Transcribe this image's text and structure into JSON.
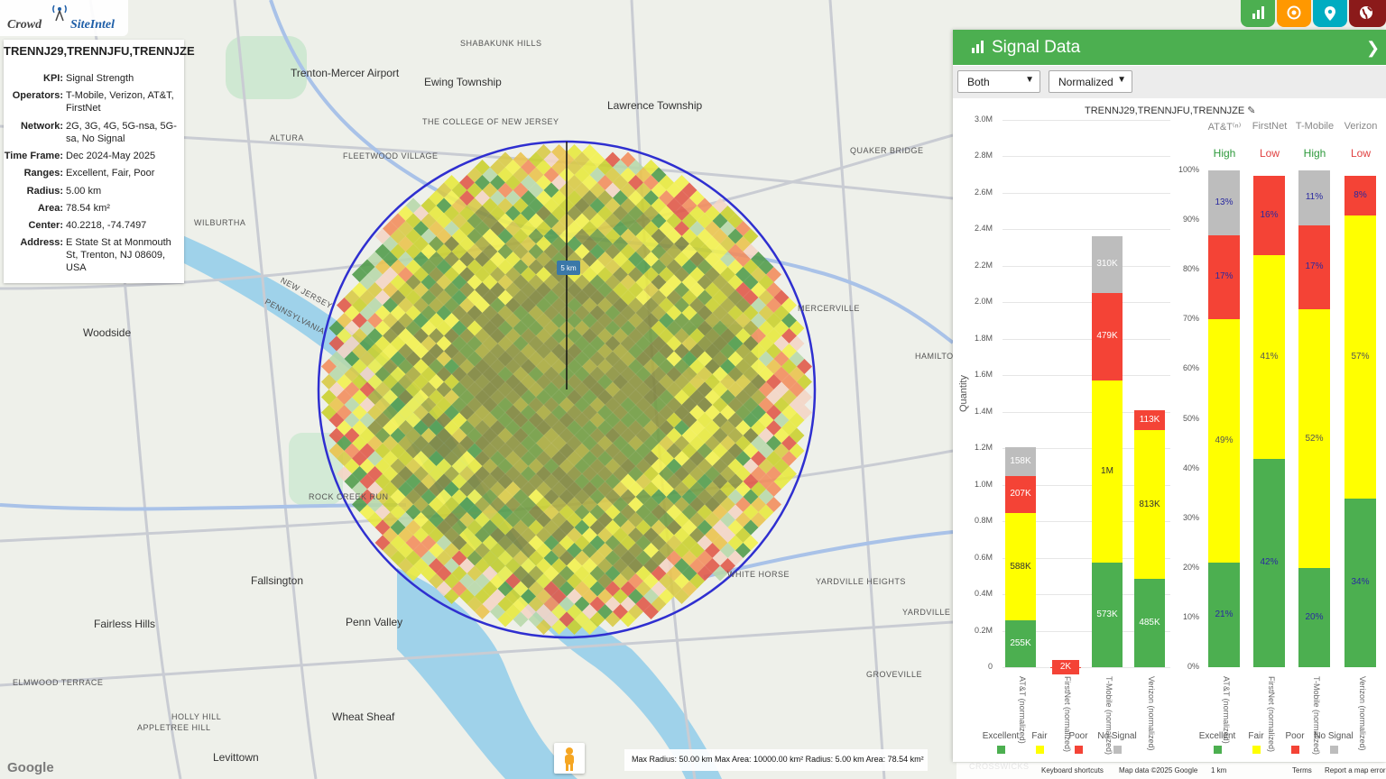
{
  "app": {
    "logo_left": "Crowd",
    "logo_right": "SiteIntel"
  },
  "info_card": {
    "title": "TRENNJ29,TRENNJFU,TRENNJZE",
    "rows": [
      {
        "key": "KPI:",
        "value": "Signal Strength"
      },
      {
        "key": "Operators:",
        "value": "T-Mobile, Verizon, AT&T, FirstNet"
      },
      {
        "key": "Network:",
        "value": "2G, 3G, 4G, 5G-nsa, 5G-sa, No Signal"
      },
      {
        "key": "Time Frame:",
        "value": "Dec 2024-May 2025"
      },
      {
        "key": "Ranges:",
        "value": "Excellent, Fair, Poor"
      },
      {
        "key": "Radius:",
        "value": "5.00 km"
      },
      {
        "key": "Area:",
        "value": "78.54 km²"
      },
      {
        "key": "Center:",
        "value": "40.2218, -74.7497"
      },
      {
        "key": "Address:",
        "value": "E State St at Monmouth St, Trenton, NJ 08609, USA"
      }
    ]
  },
  "map": {
    "places": [
      {
        "name": "Trenton-Mercer Airport",
        "style": "big"
      },
      {
        "name": "Ewing Township",
        "style": "big"
      },
      {
        "name": "Lawrence Township",
        "style": "big"
      },
      {
        "name": "Woodside",
        "style": "big"
      },
      {
        "name": "Fallsington",
        "style": "big"
      },
      {
        "name": "Fairless Hills",
        "style": "big"
      },
      {
        "name": "Penn Valley",
        "style": "big"
      },
      {
        "name": "Wheat Sheaf",
        "style": "big"
      },
      {
        "name": "Levittown",
        "style": "big"
      },
      {
        "name": "SHABAKUNK HILLS",
        "style": "small"
      },
      {
        "name": "THE COLLEGE OF NEW JERSEY",
        "style": "small"
      },
      {
        "name": "ALTURA",
        "style": "small"
      },
      {
        "name": "FLEETWOOD VILLAGE",
        "style": "small"
      },
      {
        "name": "WILBURTHA",
        "style": "small"
      },
      {
        "name": "QUAKER BRIDGE",
        "style": "small"
      },
      {
        "name": "MERCERVILLE",
        "style": "small"
      },
      {
        "name": "HAMILTON SQUARE",
        "style": "small"
      },
      {
        "name": "WHITE HORSE",
        "style": "small"
      },
      {
        "name": "YARDVILLE HEIGHTS",
        "style": "small"
      },
      {
        "name": "YARDVILLE",
        "style": "small"
      },
      {
        "name": "GROVEVILLE",
        "style": "small"
      },
      {
        "name": "ELMWOOD TERRACE",
        "style": "small"
      },
      {
        "name": "HOLLY HILL",
        "style": "small"
      },
      {
        "name": "APPLETREE HILL",
        "style": "small"
      },
      {
        "name": "ROCK CREEK RUN",
        "style": "small"
      },
      {
        "name": "CROSSWICKS",
        "style": "small"
      },
      {
        "name": "NEW JERSEY",
        "style": "small"
      },
      {
        "name": "PENNSYLVANIA",
        "style": "small"
      }
    ],
    "scale_label": "5 km",
    "radius_bar": "Max Radius: 50.00 km Max Area: 10000.00 km² Radius: 5.00 km Area: 78.54 km²",
    "google": "Google",
    "attribution": [
      "Keyboard shortcuts",
      "Map data ©2025 Google",
      "1 km",
      "Terms",
      "Report a map error"
    ]
  },
  "toolbar_buttons": [
    {
      "name": "chart-button",
      "color": "#4caf50"
    },
    {
      "name": "target-button",
      "color": "#ff9800"
    },
    {
      "name": "location-button",
      "color": "#00acc1"
    },
    {
      "name": "globe-button",
      "color": "#8b1a1a"
    }
  ],
  "panel": {
    "title": "Signal Data",
    "select_mode": "Both",
    "select_scale": "Normalized",
    "chart_title": "TRENNJ29,TRENNJFU,TRENNJZE",
    "colors": {
      "excellent": "#4caf50",
      "fair": "#ffff00",
      "poor": "#f44336",
      "no_signal": "#bdbdbd",
      "header": "#4caf50"
    }
  },
  "chart_data": [
    {
      "type": "bar",
      "stacked": true,
      "title": "TRENNJ29,TRENNJFU,TRENNJZE",
      "ylabel": "Quantity",
      "ylim": [
        0,
        3000000
      ],
      "yticks": [
        "0",
        "0.2M",
        "0.4M",
        "0.6M",
        "0.8M",
        "1.0M",
        "1.2M",
        "1.4M",
        "1.6M",
        "1.8M",
        "2.0M",
        "2.2M",
        "2.4M",
        "2.6M",
        "2.8M",
        "3.0M"
      ],
      "categories": [
        "AT&T (normalized)",
        "FirstNet (normalized)",
        "T-Mobile (normalized)",
        "Verizon (normalized)"
      ],
      "series": [
        {
          "name": "Excellent",
          "values": [
            255000,
            0,
            573000,
            485000
          ],
          "labels": [
            "255K",
            "",
            "573K",
            "485K"
          ]
        },
        {
          "name": "Fair",
          "values": [
            588000,
            0,
            1000000,
            813000
          ],
          "labels": [
            "588K",
            "",
            "1M",
            "813K"
          ]
        },
        {
          "name": "Poor",
          "values": [
            207000,
            2000,
            479000,
            113000
          ],
          "labels": [
            "207K",
            "2K",
            "479K",
            "113K"
          ]
        },
        {
          "name": "No Signal",
          "values": [
            158000,
            0,
            310000,
            0
          ],
          "labels": [
            "158K",
            "",
            "310K",
            ""
          ]
        }
      ],
      "legend": [
        "Excellent",
        "Fair",
        "Poor",
        "No Signal"
      ]
    },
    {
      "type": "bar",
      "stacked": true,
      "percent": true,
      "ylim": [
        0,
        100
      ],
      "yticks": [
        "0%",
        "10%",
        "20%",
        "30%",
        "40%",
        "50%",
        "60%",
        "70%",
        "80%",
        "90%",
        "100%"
      ],
      "headers": [
        "AT&T⁽ⁿ⁾",
        "FirstNet",
        "T-Mobile",
        "Verizon"
      ],
      "ratings": [
        "High",
        "Low",
        "High",
        "Low"
      ],
      "categories": [
        "AT&T (normalized)",
        "FirstNet (normalized)",
        "T-Mobile (normalized)",
        "Verizon (normalized)"
      ],
      "series": [
        {
          "name": "Excellent",
          "values": [
            21,
            42,
            20,
            34
          ],
          "labels": [
            "21%",
            "42%",
            "20%",
            "34%"
          ]
        },
        {
          "name": "Fair",
          "values": [
            49,
            41,
            52,
            57
          ],
          "labels": [
            "49%",
            "41%",
            "52%",
            "57%"
          ]
        },
        {
          "name": "Poor",
          "values": [
            17,
            16,
            17,
            8
          ],
          "labels": [
            "17%",
            "16%",
            "17%",
            "8%"
          ]
        },
        {
          "name": "No Signal",
          "values": [
            13,
            0,
            11,
            0
          ],
          "labels": [
            "13%",
            "",
            "11%",
            ""
          ]
        }
      ],
      "legend": [
        "Excellent",
        "Fair",
        "Poor",
        "No Signal"
      ]
    }
  ]
}
